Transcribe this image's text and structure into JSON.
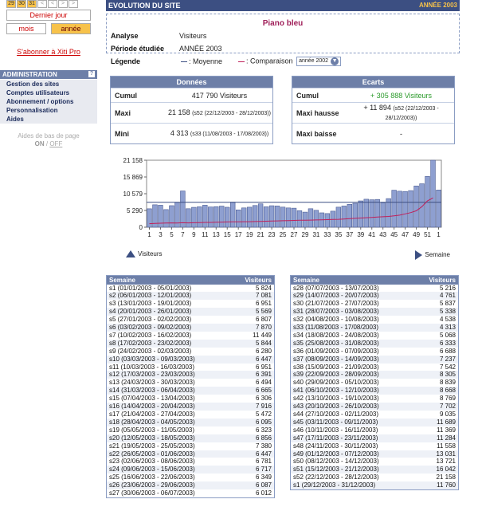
{
  "sidebar": {
    "calendar": [
      "29",
      "30",
      "31",
      "<",
      "<",
      ">",
      ">"
    ],
    "dernier_jour": "Dernier jour",
    "mois": "mois",
    "annee": "année",
    "subscribe": "S'abonner à Xiti Pro",
    "admin_title": "ADMINISTRATION",
    "admin_help": "?",
    "admin_items": [
      "Gestion des sites",
      "Comptes utilisateurs",
      "Abonnement / options",
      "Personnalisation",
      "Aides"
    ],
    "aides_bas": "Aides de bas de page",
    "on": "ON",
    "off": "OFF"
  },
  "header": {
    "title": "EVOLUTION DU SITE",
    "year": "ANNÉE 2003"
  },
  "info": {
    "site": "Piano bleu",
    "analyse_label": "Analyse",
    "analyse_value": "Visiteurs",
    "periode_label": "Période étudiée",
    "periode_value": "ANNÉE 2003",
    "legende_label": "Légende",
    "moyenne": ": Moyenne",
    "comparaison": ": Comparaison",
    "compare_select": "année 2002"
  },
  "donnees": {
    "title": "Données",
    "rows": [
      {
        "k": "Cumul",
        "v": "417 790 Visiteurs",
        "s": ""
      },
      {
        "k": "Maxi",
        "v": "21 158",
        "s": "(s52 (22/12/2003 - 28/12/2003))"
      },
      {
        "k": "Mini",
        "v": "4 313",
        "s": "(s33 (11/08/2003 - 17/08/2003))"
      }
    ]
  },
  "ecarts": {
    "title": "Ecarts",
    "rows": [
      {
        "k": "Cumul",
        "v": "+ 305 888 Visiteurs",
        "s": ""
      },
      {
        "k": "Maxi hausse",
        "v": "+ 11 894",
        "s": "(s52 (22/12/2003 - 28/12/2003))"
      },
      {
        "k": "Maxi baisse",
        "v": "-",
        "s": ""
      }
    ]
  },
  "chart_data": {
    "type": "bar",
    "yticks": [
      "21 158",
      "15 869",
      "10 579",
      "5 290",
      "0"
    ],
    "xticks": [
      "1",
      "3",
      "5",
      "7",
      "9",
      "11",
      "13",
      "15",
      "17",
      "19",
      "21",
      "23",
      "25",
      "27",
      "29",
      "31",
      "33",
      "35",
      "37",
      "39",
      "41",
      "43",
      "45",
      "47",
      "49",
      "51",
      "1"
    ],
    "ylim": [
      0,
      21158
    ],
    "mean": 7860,
    "legend_visiteurs": "Visiteurs",
    "legend_semaine": "Semaine",
    "colors": {
      "bar": "#8e9fd0",
      "bar_border": "#4b5c93",
      "mean": "#3c4f82",
      "compare": "#c0205a"
    },
    "values": [
      5824,
      7081,
      6951,
      5569,
      6807,
      7870,
      11449,
      5844,
      6280,
      6447,
      6951,
      6391,
      6494,
      6665,
      6306,
      7916,
      5472,
      6095,
      6323,
      6856,
      7380,
      6447,
      6781,
      6717,
      6349,
      6087,
      6012,
      5216,
      4761,
      5837,
      5338,
      4538,
      4313,
      5068,
      6333,
      6688,
      7237,
      7542,
      8305,
      8839,
      8668,
      8769,
      7702,
      9035,
      11689,
      11369,
      11284,
      11558,
      13031,
      13721,
      16042,
      21158,
      11760
    ],
    "compare": [
      1100,
      1200,
      1250,
      1300,
      1350,
      1300,
      1400,
      1350,
      1400,
      1450,
      1500,
      1500,
      1550,
      1600,
      1650,
      1700,
      1700,
      1750,
      1750,
      1800,
      1850,
      1900,
      1950,
      2000,
      2050,
      2100,
      2150,
      2200,
      2200,
      2250,
      2300,
      2350,
      2400,
      2450,
      2500,
      2600,
      2700,
      2800,
      2900,
      3000,
      3100,
      3200,
      3300,
      3400,
      3600,
      3800,
      4200,
      4600,
      5200,
      6500,
      8300,
      9264,
      0
    ]
  },
  "table": {
    "col_semaine": "Semaine",
    "col_visiteurs": "Visiteurs",
    "left": [
      [
        "s1 (01/01/2003 - 05/01/2003)",
        "5 824"
      ],
      [
        "s2 (06/01/2003 - 12/01/2003)",
        "7 081"
      ],
      [
        "s3 (13/01/2003 - 19/01/2003)",
        "6 951"
      ],
      [
        "s4 (20/01/2003 - 26/01/2003)",
        "5 569"
      ],
      [
        "s5 (27/01/2003 - 02/02/2003)",
        "6 807"
      ],
      [
        "s6 (03/02/2003 - 09/02/2003)",
        "7 870"
      ],
      [
        "s7 (10/02/2003 - 16/02/2003)",
        "11 449"
      ],
      [
        "s8 (17/02/2003 - 23/02/2003)",
        "5 844"
      ],
      [
        "s9 (24/02/2003 - 02/03/2003)",
        "6 280"
      ],
      [
        "s10 (03/03/2003 - 09/03/2003)",
        "6 447"
      ],
      [
        "s11 (10/03/2003 - 16/03/2003)",
        "6 951"
      ],
      [
        "s12 (17/03/2003 - 23/03/2003)",
        "6 391"
      ],
      [
        "s13 (24/03/2003 - 30/03/2003)",
        "6 494"
      ],
      [
        "s14 (31/03/2003 - 06/04/2003)",
        "6 665"
      ],
      [
        "s15 (07/04/2003 - 13/04/2003)",
        "6 306"
      ],
      [
        "s16 (14/04/2003 - 20/04/2003)",
        "7 916"
      ],
      [
        "s17 (21/04/2003 - 27/04/2003)",
        "5 472"
      ],
      [
        "s18 (28/04/2003 - 04/05/2003)",
        "6 095"
      ],
      [
        "s19 (05/05/2003 - 11/05/2003)",
        "6 323"
      ],
      [
        "s20 (12/05/2003 - 18/05/2003)",
        "6 856"
      ],
      [
        "s21 (19/05/2003 - 25/05/2003)",
        "7 380"
      ],
      [
        "s22 (26/05/2003 - 01/06/2003)",
        "6 447"
      ],
      [
        "s23 (02/06/2003 - 08/06/2003)",
        "6 781"
      ],
      [
        "s24 (09/06/2003 - 15/06/2003)",
        "6 717"
      ],
      [
        "s25 (16/06/2003 - 22/06/2003)",
        "6 349"
      ],
      [
        "s26 (23/06/2003 - 29/06/2003)",
        "6 087"
      ],
      [
        "s27 (30/06/2003 - 06/07/2003)",
        "6 012"
      ]
    ],
    "right": [
      [
        "s28 (07/07/2003 - 13/07/2003)",
        "5 216"
      ],
      [
        "s29 (14/07/2003 - 20/07/2003)",
        "4 761"
      ],
      [
        "s30 (21/07/2003 - 27/07/2003)",
        "5 837"
      ],
      [
        "s31 (28/07/2003 - 03/08/2003)",
        "5 338"
      ],
      [
        "s32 (04/08/2003 - 10/08/2003)",
        "4 538"
      ],
      [
        "s33 (11/08/2003 - 17/08/2003)",
        "4 313"
      ],
      [
        "s34 (18/08/2003 - 24/08/2003)",
        "5 068"
      ],
      [
        "s35 (25/08/2003 - 31/08/2003)",
        "6 333"
      ],
      [
        "s36 (01/09/2003 - 07/09/2003)",
        "6 688"
      ],
      [
        "s37 (08/09/2003 - 14/09/2003)",
        "7 237"
      ],
      [
        "s38 (15/09/2003 - 21/09/2003)",
        "7 542"
      ],
      [
        "s39 (22/09/2003 - 28/09/2003)",
        "8 305"
      ],
      [
        "s40 (29/09/2003 - 05/10/2003)",
        "8 839"
      ],
      [
        "s41 (06/10/2003 - 12/10/2003)",
        "8 668"
      ],
      [
        "s42 (13/10/2003 - 19/10/2003)",
        "8 769"
      ],
      [
        "s43 (20/10/2003 - 26/10/2003)",
        "7 702"
      ],
      [
        "s44 (27/10/2003 - 02/11/2003)",
        "9 035"
      ],
      [
        "s45 (03/11/2003 - 09/11/2003)",
        "11 689"
      ],
      [
        "s46 (10/11/2003 - 16/11/2003)",
        "11 369"
      ],
      [
        "s47 (17/11/2003 - 23/11/2003)",
        "11 284"
      ],
      [
        "s48 (24/11/2003 - 30/11/2003)",
        "11 558"
      ],
      [
        "s49 (01/12/2003 - 07/12/2003)",
        "13 031"
      ],
      [
        "s50 (08/12/2003 - 14/12/2003)",
        "13 721"
      ],
      [
        "s51 (15/12/2003 - 21/12/2003)",
        "16 042"
      ],
      [
        "s52 (22/12/2003 - 28/12/2003)",
        "21 158"
      ],
      [
        "s1 (29/12/2003 - 31/12/2003)",
        "11 760"
      ]
    ]
  }
}
